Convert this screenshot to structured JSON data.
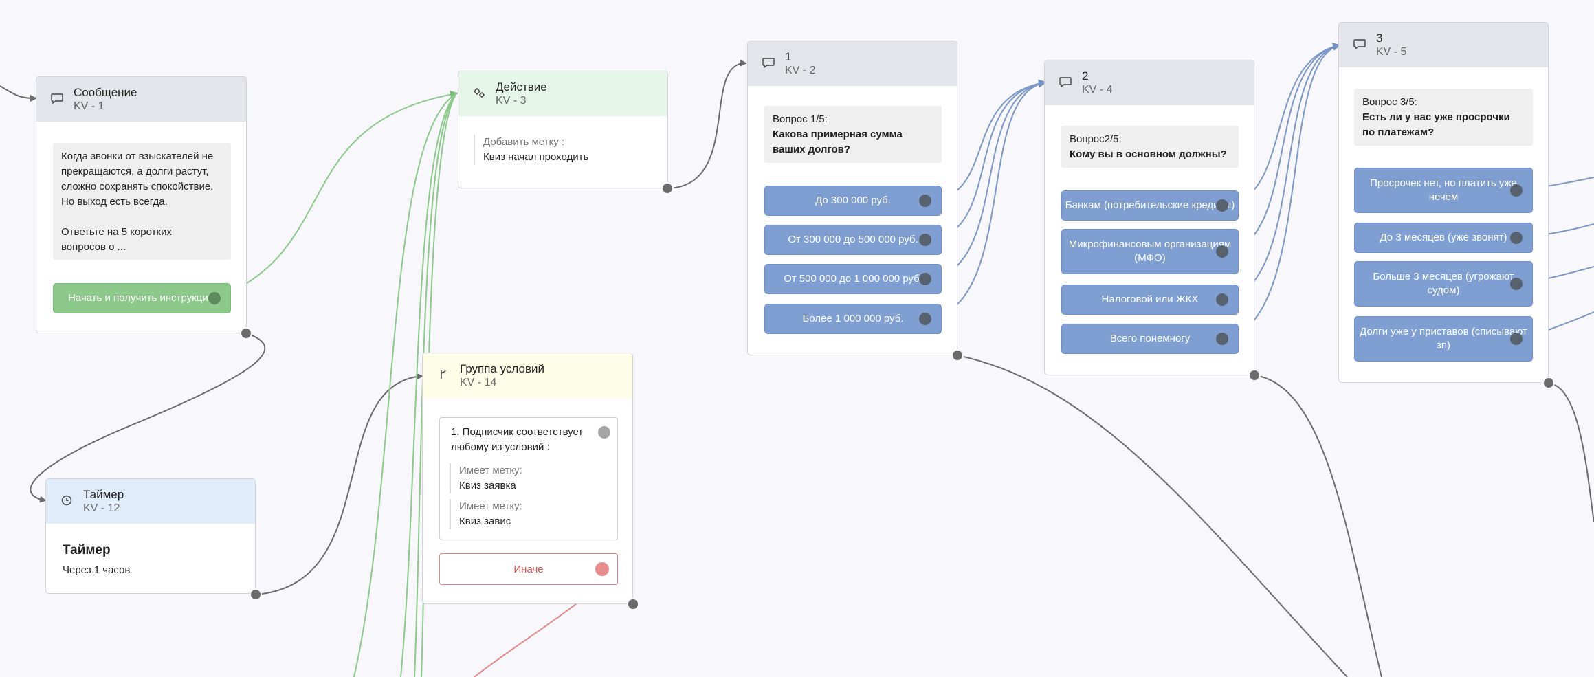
{
  "nodes": {
    "message": {
      "title": "Сообщение",
      "sub": "KV - 1",
      "text_lines": [
        "Когда звонки от взыскателей не",
        "прекращаются, а долги растут,",
        "сложно сохранять спокойствие.",
        "Но выход есть всегда.",
        "",
        "Ответьте на 5 коротких",
        "вопросов о ..."
      ],
      "button": "Начать и получить инструкцию"
    },
    "action": {
      "title": "Действие",
      "sub": "KV - 3",
      "tag_label": "Добавить метку :",
      "tag_value": "Квиз начал проходить"
    },
    "timer": {
      "title": "Таймер",
      "sub": "KV - 12",
      "body_title": "Таймер",
      "body_text": "Через 1 часов"
    },
    "conditions": {
      "title": "Группа условий",
      "sub": "KV - 14",
      "cond_title": "1. Подписчик соответствует любому из условий :",
      "rules": [
        {
          "label": "Имеет метку:",
          "value": "Квиз заявка"
        },
        {
          "label": "Имеет метку:",
          "value": "Квиз завис"
        }
      ],
      "else_label": "Иначе"
    },
    "q1": {
      "title": "1",
      "sub": "KV - 2",
      "q_label": "Вопрос 1/5:",
      "q_text": "Какова примерная сумма ваших долгов?",
      "buttons": [
        "До 300 000 руб.",
        "От 300 000 до 500 000 руб.",
        "От 500 000 до 1 000 000 руб.",
        "Более 1 000 000 руб."
      ]
    },
    "q2": {
      "title": "2",
      "sub": "KV - 4",
      "q_label": "Вопрос2/5:",
      "q_text": "Кому вы в основном должны?",
      "buttons": [
        "Банкам (потребительские кредиты)",
        "Микрофинансовым организациям (МФО)",
        "Налоговой или ЖКХ",
        "Всего понемногу"
      ]
    },
    "q3": {
      "title": "3",
      "sub": "KV - 5",
      "q_label": "Вопрос 3/5:",
      "q_text": "Есть ли у вас уже просрочки по платежам?",
      "buttons": [
        "Просрочек нет, но платить уже нечем",
        "До 3 месяцев (уже звонят)",
        "Больше 3 месяцев (угрожают судом)",
        "Долги уже у приставов (списывают зп)"
      ]
    }
  },
  "colors": {
    "edge_gray": "#6b6b6b",
    "edge_green": "#8cc98a",
    "edge_blue": "#7a97c6",
    "edge_red": "#e38a8a"
  }
}
